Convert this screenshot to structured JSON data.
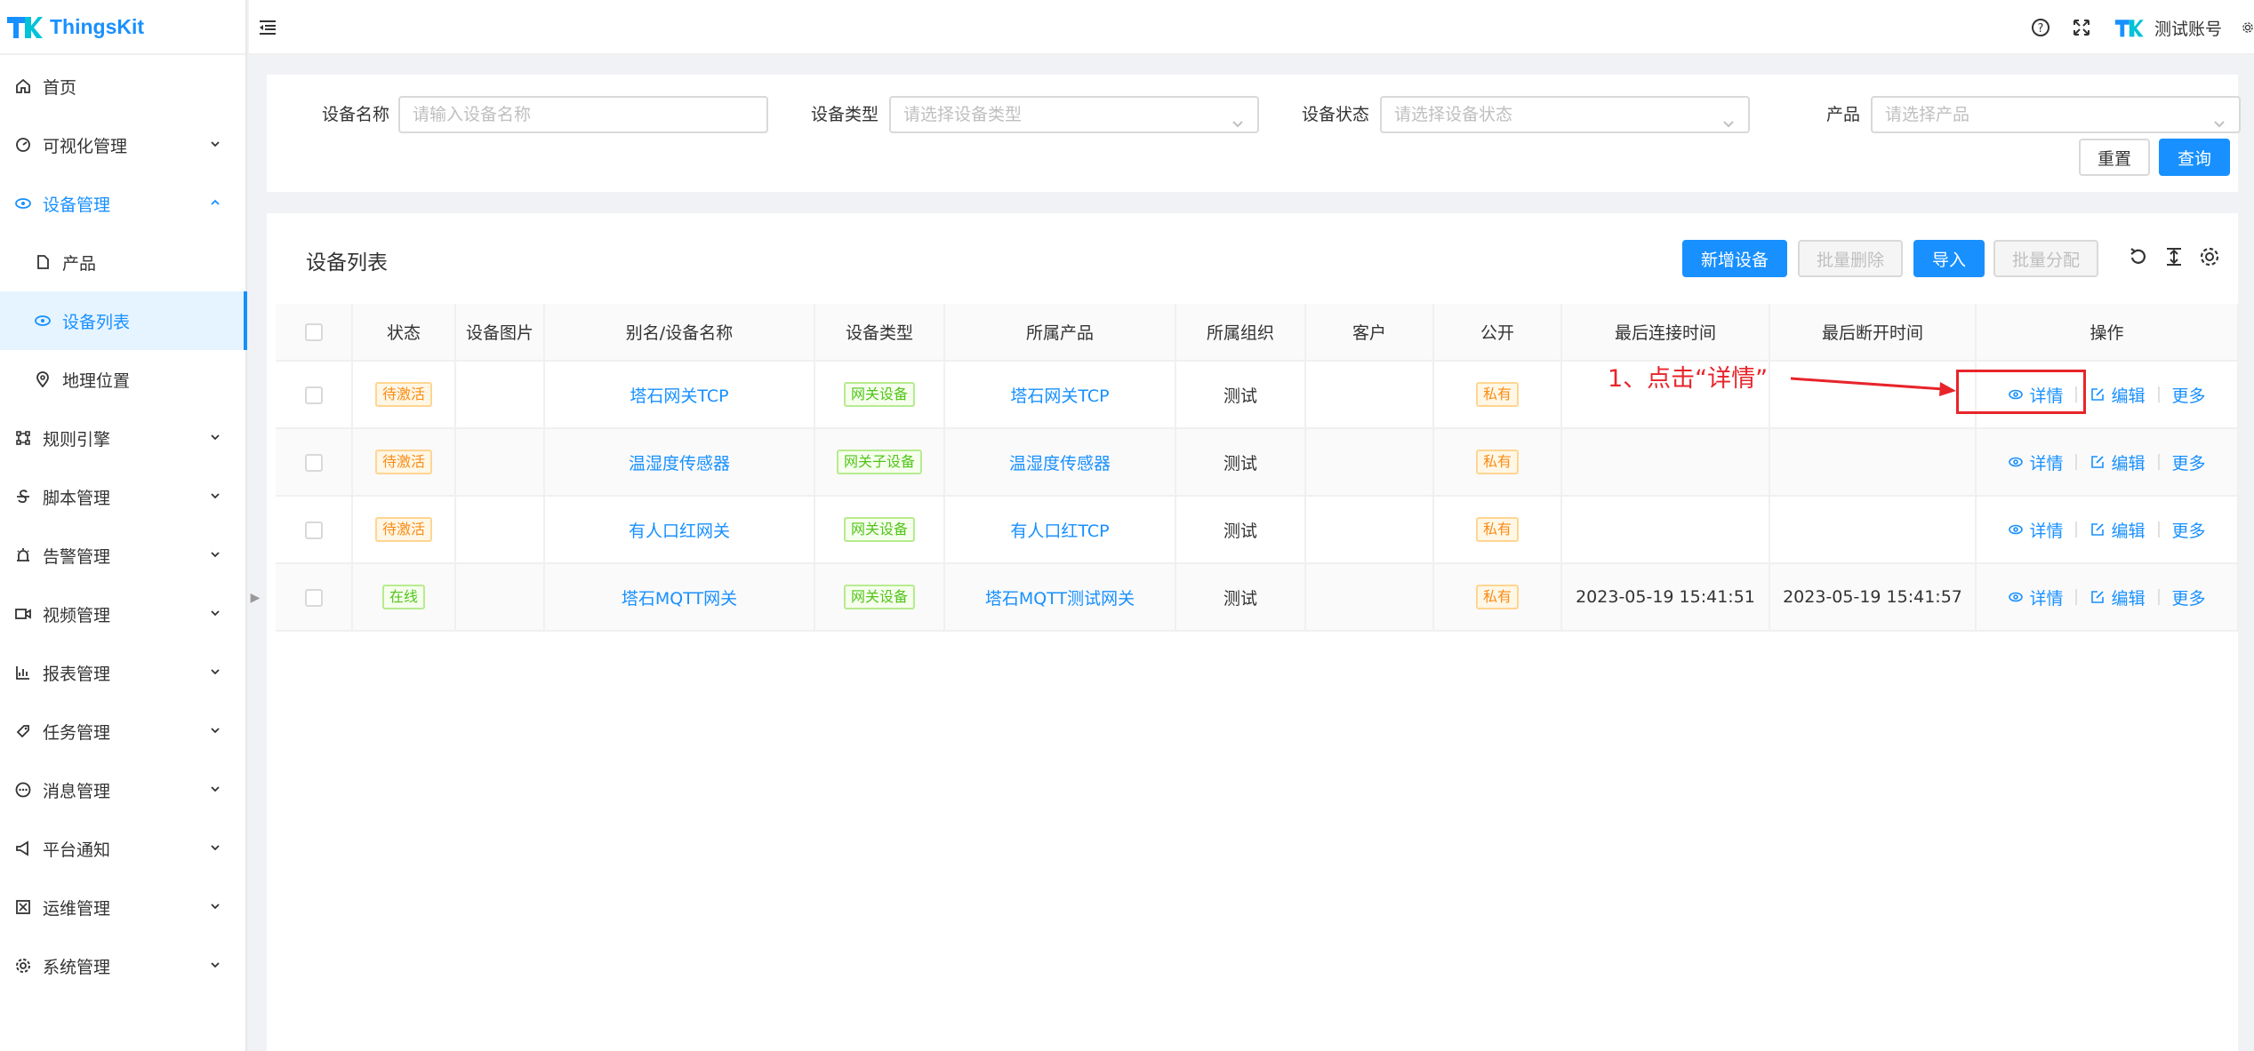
{
  "app": {
    "name": "ThingsKit",
    "brand_color": "#1890ff"
  },
  "header": {
    "user_name": "测试账号"
  },
  "sidebar": {
    "items": [
      {
        "label": "首页",
        "icon": "home-icon",
        "type": "top",
        "chevron": ""
      },
      {
        "label": "可视化管理",
        "icon": "dashboard-icon",
        "type": "top",
        "chevron": "down"
      },
      {
        "label": "设备管理",
        "icon": "device-icon",
        "type": "open",
        "chevron": "up"
      },
      {
        "label": "产品",
        "icon": "product-icon",
        "type": "sub",
        "chevron": ""
      },
      {
        "label": "设备列表",
        "icon": "device-list-icon",
        "type": "active",
        "chevron": ""
      },
      {
        "label": "地理位置",
        "icon": "location-icon",
        "type": "sub",
        "chevron": ""
      },
      {
        "label": "规则引擎",
        "icon": "rule-icon",
        "type": "top",
        "chevron": "down"
      },
      {
        "label": "脚本管理",
        "icon": "script-icon",
        "type": "top",
        "chevron": "down"
      },
      {
        "label": "告警管理",
        "icon": "alarm-icon",
        "type": "top",
        "chevron": "down"
      },
      {
        "label": "视频管理",
        "icon": "video-icon",
        "type": "top",
        "chevron": "down"
      },
      {
        "label": "报表管理",
        "icon": "report-icon",
        "type": "top",
        "chevron": "down"
      },
      {
        "label": "任务管理",
        "icon": "task-icon",
        "type": "top",
        "chevron": "down"
      },
      {
        "label": "消息管理",
        "icon": "message-icon",
        "type": "top",
        "chevron": "down"
      },
      {
        "label": "平台通知",
        "icon": "notice-icon",
        "type": "top",
        "chevron": "down"
      },
      {
        "label": "运维管理",
        "icon": "ops-icon",
        "type": "top",
        "chevron": "down"
      },
      {
        "label": "系统管理",
        "icon": "system-icon",
        "type": "top",
        "chevron": "down"
      }
    ]
  },
  "filter": {
    "device_name_label": "设备名称",
    "device_name_placeholder": "请输入设备名称",
    "device_type_label": "设备类型",
    "device_type_placeholder": "请选择设备类型",
    "device_status_label": "设备状态",
    "device_status_placeholder": "请选择设备状态",
    "product_label": "产品",
    "product_placeholder": "请选择产品",
    "reset_label": "重置",
    "query_label": "查询"
  },
  "list": {
    "title": "设备列表",
    "add_label": "新增设备",
    "batch_delete_label": "批量删除",
    "import_label": "导入",
    "batch_assign_label": "批量分配",
    "columns": [
      "状态",
      "设备图片",
      "别名/设备名称",
      "设备类型",
      "所属产品",
      "所属组织",
      "客户",
      "公开",
      "最后连接时间",
      "最后断开时间",
      "操作"
    ],
    "rows": [
      {
        "status": "待激活",
        "status_color": "orange",
        "name": "塔石网关TCP",
        "type": "网关设备",
        "product": "塔石网关TCP",
        "org": "测试",
        "customer": "",
        "public": "私有",
        "last_connect": "",
        "last_disconnect": ""
      },
      {
        "status": "待激活",
        "status_color": "orange",
        "name": "温湿度传感器",
        "type": "网关子设备",
        "product": "温湿度传感器",
        "org": "测试",
        "customer": "",
        "public": "私有",
        "last_connect": "",
        "last_disconnect": ""
      },
      {
        "status": "待激活",
        "status_color": "orange",
        "name": "有人口红网关",
        "type": "网关设备",
        "product": "有人口红TCP",
        "org": "测试",
        "customer": "",
        "public": "私有",
        "last_connect": "",
        "last_disconnect": ""
      },
      {
        "status": "在线",
        "status_color": "green",
        "name": "塔石MQTT网关",
        "type": "网关设备",
        "product": "塔石MQTT测试网关",
        "org": "测试",
        "customer": "",
        "public": "私有",
        "last_connect": "2023-05-19 15:41:51",
        "last_disconnect": "2023-05-19 15:41:57"
      }
    ],
    "actions": {
      "detail": "详情",
      "edit": "编辑",
      "more": "更多"
    }
  },
  "annotation": {
    "text": "1、点击“详情”",
    "color": "#e8242b"
  }
}
